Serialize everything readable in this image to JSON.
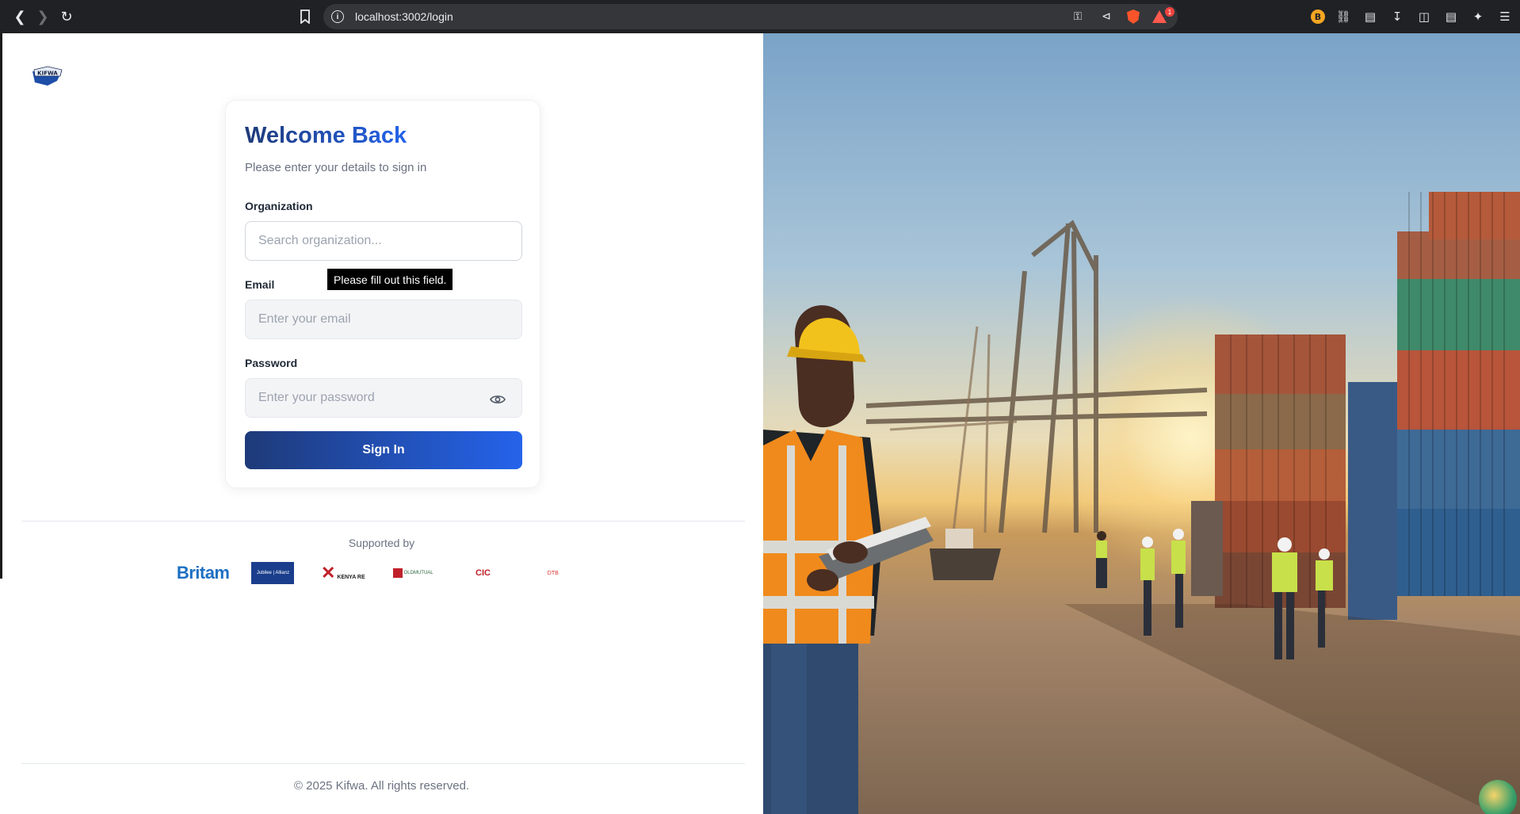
{
  "browser": {
    "url": "localhost:3002/login",
    "notification_count": "1",
    "profile_initial": "B"
  },
  "login": {
    "title": "Welcome Back",
    "subtitle": "Please enter your details to sign in",
    "organization_label": "Organization",
    "organization_placeholder": "Search organization...",
    "email_label": "Email",
    "email_placeholder": "Enter your email",
    "password_label": "Password",
    "password_placeholder": "Enter your password",
    "signin_label": "Sign In",
    "validation_tooltip": "Please fill out this field."
  },
  "sponsors": {
    "heading": "Supported by",
    "partners": [
      {
        "name": "Britam",
        "text": "Britam"
      },
      {
        "name": "Jubilee Allianz",
        "text": "Jubilee | Allianz"
      },
      {
        "name": "Kenya Re",
        "text": "KENYA RE"
      },
      {
        "name": "Old Mutual",
        "text": "OLDMUTUAL"
      },
      {
        "name": "CIC Group",
        "text": "CIC"
      },
      {
        "name": "DTB",
        "text": "DTB"
      }
    ]
  },
  "footer": {
    "copyright": "© 2025 Kifwa. All rights reserved."
  },
  "brand": {
    "logo_text": "KIFWA",
    "primary_dark": "#1e3a78",
    "primary": "#2563eb"
  }
}
